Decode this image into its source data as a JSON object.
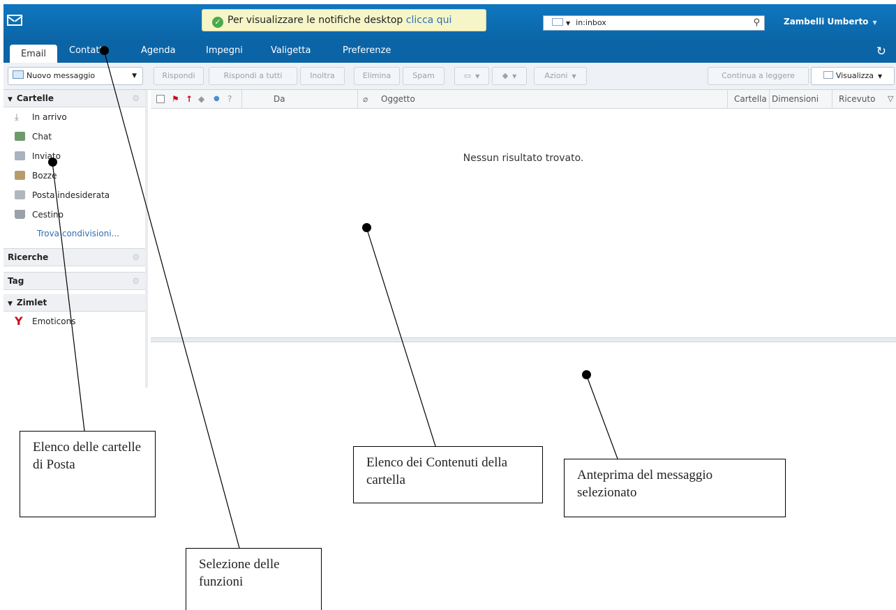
{
  "app": {
    "notification_text": "Per visualizzare le notifiche desktop",
    "notification_link": "clicca qui",
    "search_value": "in:inbox",
    "user_name": "Zambelli Umberto"
  },
  "tabs": [
    "Email",
    "Contatti",
    "Agenda",
    "Impegni",
    "Valigetta",
    "Preferenze"
  ],
  "toolbar": {
    "new_message": "Nuovo messaggio",
    "reply": "Rispondi",
    "reply_all": "Rispondi a tutti",
    "forward": "Inoltra",
    "delete": "Elimina",
    "spam": "Spam",
    "actions": "Azioni",
    "continue_reading": "Continua a leggere",
    "view": "Visualizza"
  },
  "sidebar": {
    "folders_title": "Cartelle",
    "folders": [
      "In arrivo",
      "Chat",
      "Inviato",
      "Bozze",
      "Posta indesiderata",
      "Cestino"
    ],
    "find_shares": "Trova condivisioni...",
    "searches_title": "Ricerche",
    "tags_title": "Tag",
    "zimlets_title": "Zimlet",
    "zimlet_item": "Emoticons"
  },
  "list": {
    "col_from": "Da",
    "col_subject": "Oggetto",
    "col_folder": "Cartella",
    "col_size": "Dimensioni",
    "col_received": "Ricevuto",
    "empty_message": "Nessun risultato trovato."
  },
  "callouts": {
    "folders": "Elenco delle cartelle di Posta",
    "functions": "Selezione delle funzioni",
    "contents": "Elenco dei Contenuti della cartella",
    "preview": "Anteprima del messaggio selezionato"
  }
}
